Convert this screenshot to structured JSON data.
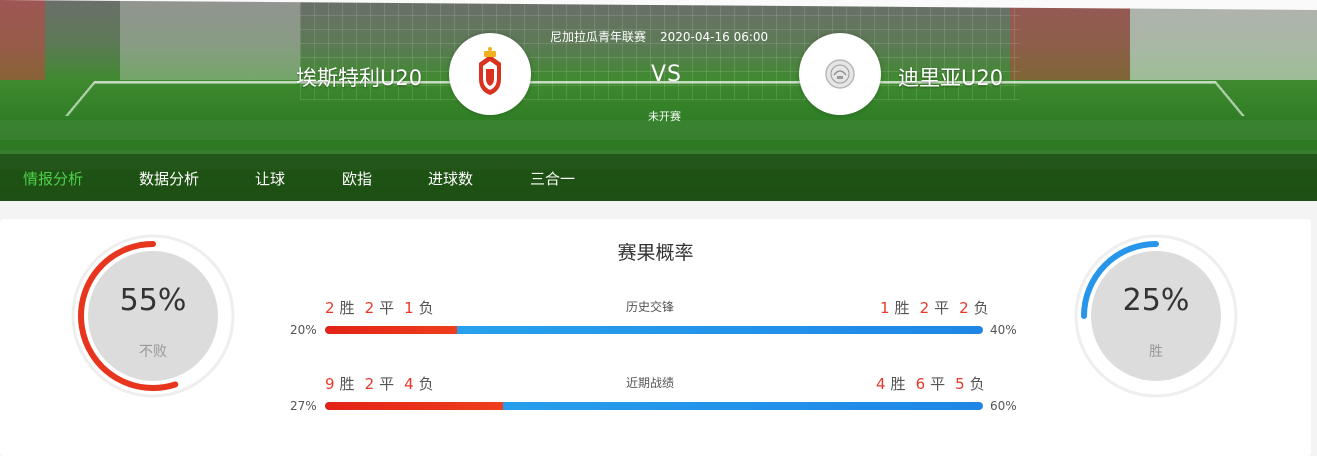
{
  "match": {
    "league": "尼加拉瓜青年联赛",
    "datetime": "2020-04-16 06:00",
    "vs": "VS",
    "status": "未开赛",
    "home_team": "埃斯特利U20",
    "away_team": "迪里亚U20",
    "home_logo": "home-team-crest-icon",
    "away_logo": "away-team-crest-icon"
  },
  "tabs": [
    {
      "label": "情报分析",
      "active": true
    },
    {
      "label": "数据分析",
      "active": false
    },
    {
      "label": "让球",
      "active": false
    },
    {
      "label": "欧指",
      "active": false
    },
    {
      "label": "进球数",
      "active": false
    },
    {
      "label": "三合一",
      "active": false
    }
  ],
  "probability": {
    "title": "赛果概率",
    "home": {
      "percent": "55%",
      "label": "不败",
      "value": 0.55,
      "color": "#e8361e"
    },
    "away": {
      "percent": "25%",
      "label": "胜",
      "value": 0.25,
      "color": "#2796ea"
    }
  },
  "records": [
    {
      "label": "历史交锋",
      "home": {
        "w": "2",
        "d": "2",
        "l": "1"
      },
      "away": {
        "w": "1",
        "d": "2",
        "l": "2"
      },
      "home_pct": "20%",
      "away_pct": "40%",
      "home_fill": 0.2
    },
    {
      "label": "近期战绩",
      "home": {
        "w": "9",
        "d": "2",
        "l": "4"
      },
      "away": {
        "w": "4",
        "d": "6",
        "l": "5"
      },
      "home_pct": "27%",
      "away_pct": "60%",
      "home_fill": 0.27
    }
  ],
  "words": {
    "win": "胜",
    "draw": "平",
    "loss": "负"
  },
  "colors": {
    "accent_green": "#4dd04a",
    "home_red": "#e8382a",
    "away_blue": "#2796ea"
  }
}
